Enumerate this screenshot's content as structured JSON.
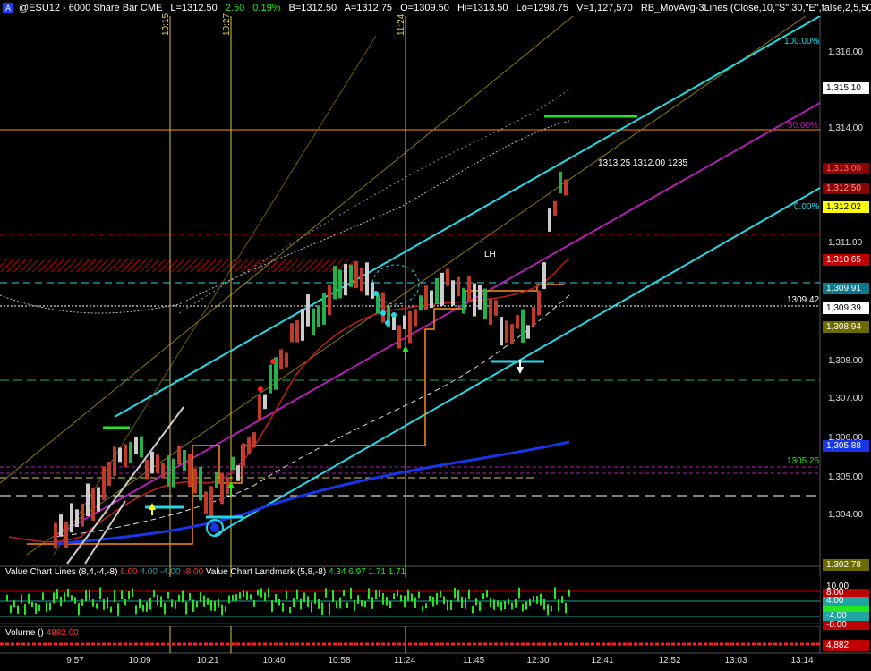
{
  "header": {
    "badge": "A",
    "symbol": "@ESU12 - 6000 Share Bar  CME",
    "last": "L=1312.50",
    "change": "2.50",
    "change_pct": "0.19%",
    "bid": "B=1312.50",
    "ask": "A=1312.75",
    "open": "O=1309.50",
    "high": "Hi=1313.50",
    "low": "Lo=1298.75",
    "volume": "V=1,127,570",
    "study": "RB_MovAvg-3Lines (Close,10,\"S\",30,\"E\",false,2,5,50"
  },
  "colors": {
    "background": "#000000",
    "channel": "#26d7e6",
    "midline": "#b01fb0",
    "price_up": "#22b14c",
    "price_down": "#c0392b",
    "orange": "#ff8c1a",
    "ma_blue": "#1836e6",
    "time_marker": "#d8c640"
  },
  "price_axis": {
    "ticks": [
      "1,316.00",
      "1,314.00",
      "1,311.00",
      "1,307.00",
      "1,306.00",
      "1,305.00",
      "1,304.00",
      "1,308.00"
    ],
    "tags": [
      {
        "label": "1,315.10",
        "bg": "#ffffff",
        "fg": "#000000"
      },
      {
        "label": "1,313.00",
        "bg": "#8b0000",
        "fg": "#ff6b6b"
      },
      {
        "label": "1,312.50",
        "bg": "#8b0000",
        "fg": "#ff9a9a"
      },
      {
        "label": "1,312.02",
        "bg": "#ffff00",
        "fg": "#000000"
      },
      {
        "label": "1,310.65",
        "bg": "#c00000",
        "fg": "#ffffff"
      },
      {
        "label": "1,309.91",
        "bg": "#0a7a8a",
        "fg": "#ffffff"
      },
      {
        "label": "1,309.39",
        "bg": "#ffffff",
        "fg": "#000000"
      },
      {
        "label": "1,308.94",
        "bg": "#6b6b00",
        "fg": "#ffffff"
      },
      {
        "label": "1,305.88",
        "bg": "#1836e6",
        "fg": "#ffffff"
      },
      {
        "label": "1,302.78",
        "bg": "#6b6b00",
        "fg": "#ffffff"
      }
    ]
  },
  "time_axis": [
    "9:57",
    "10:09",
    "10:21",
    "10:40",
    "10:58",
    "11:24",
    "11:45",
    "12:30",
    "12:41",
    "12:52",
    "13:03",
    "13:14"
  ],
  "time_markers": [
    "10:15",
    "10:27",
    "11:24"
  ],
  "fib_labels": [
    "100.00%",
    "50.00%",
    "0.00%"
  ],
  "annotations": {
    "levels": "1313.25  1312.00  1235",
    "lh": "LH",
    "level_1309": "1309.42",
    "level_1305": "1305.25"
  },
  "value_chart": {
    "title": "Value Chart Lines (8,4,-4,-8)",
    "v1": "8.00",
    "v2": "4.00",
    "v3": "-4.00",
    "v4": "-8.00",
    "landmark_title": "Value Chart Landmark (5,8,-8)",
    "l1": "4.34",
    "l2": "6.97",
    "l3": "1.71",
    "l4": "1.71",
    "axis": [
      "10.00",
      "8.00",
      "4.00",
      "-4.00",
      "-8.00"
    ]
  },
  "volume": {
    "title": "Volume ()",
    "value": "4882.00",
    "tag": "4,882"
  }
}
